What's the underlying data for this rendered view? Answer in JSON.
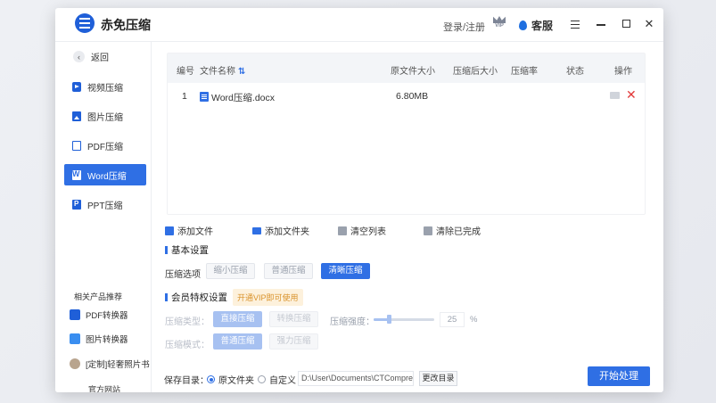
{
  "app": {
    "title": "赤免压缩",
    "login": "登录/注册",
    "vip_label": "VIP",
    "service": "客服"
  },
  "sidebar": {
    "back": "返回",
    "items": [
      {
        "label": "视频压缩",
        "icon": "video-icon"
      },
      {
        "label": "图片压缩",
        "icon": "image-icon"
      },
      {
        "label": "PDF压缩",
        "icon": "pdf-icon"
      },
      {
        "label": "Word压缩",
        "icon": "word-icon",
        "active": true
      },
      {
        "label": "PPT压缩",
        "icon": "ppt-icon"
      }
    ],
    "related_title": "相关产品推荐",
    "related": [
      {
        "label": "PDF转换器"
      },
      {
        "label": "图片转换器"
      },
      {
        "label": "[定制]轻奢照片书"
      }
    ],
    "website": "官方网站"
  },
  "table": {
    "headers": {
      "index": "编号",
      "name": "文件名称",
      "size": "原文件大小",
      "compressed_size": "压缩后大小",
      "ratio": "压缩率",
      "status": "状态",
      "action": "操作"
    },
    "rows": [
      {
        "index": "1",
        "name": "Word压缩.docx",
        "size": "6.80MB",
        "compressed_size": "",
        "ratio": "",
        "status": ""
      }
    ]
  },
  "toolbar": {
    "add_file": "添加文件",
    "add_folder": "添加文件夹",
    "clear_list": "清空列表",
    "clear_done": "清除已完成"
  },
  "basic": {
    "title": "基本设置",
    "option_label": "压缩选项",
    "options": [
      "缩小压缩",
      "普通压缩",
      "清晰压缩"
    ],
    "selected": "清晰压缩"
  },
  "vip_settings": {
    "title": "会员特权设置",
    "badge": "开通VIP即可使用",
    "type_label": "压缩类型：",
    "type_options": [
      "直接压缩",
      "转换压缩"
    ],
    "strength_label": "压缩强度：",
    "strength_value": "25",
    "strength_unit": "%",
    "mode_label": "压缩模式：",
    "mode_options": [
      "普通压缩",
      "强力压缩"
    ]
  },
  "footer": {
    "save_label": "保存目录：",
    "radio_original": "原文件夹",
    "radio_custom": "自定义",
    "path": "D:\\User\\Documents\\CTCompress",
    "change_dir": "更改目录",
    "start": "开始处理"
  },
  "colors": {
    "accent": "#2f6fe4",
    "danger": "#e23a3a",
    "vip_badge_text": "#d9922a"
  }
}
